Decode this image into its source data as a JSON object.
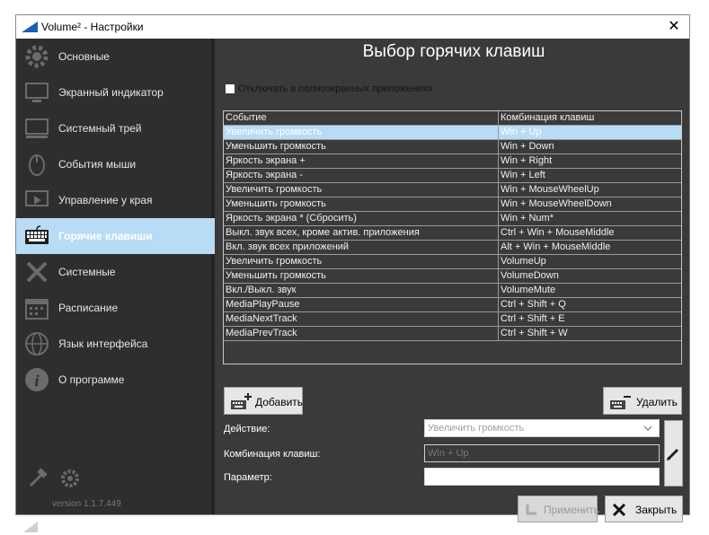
{
  "window": {
    "title": "Volume² - Настройки",
    "close_glyph": "✕",
    "accent_color": "#b8dcf5"
  },
  "sidebar": {
    "items": [
      {
        "label": "Основные",
        "icon": "gear-icon"
      },
      {
        "label": "Экранный индикатор",
        "icon": "monitor-icon"
      },
      {
        "label": "Системный трей",
        "icon": "tray-icon"
      },
      {
        "label": "События мыши",
        "icon": "mouse-icon"
      },
      {
        "label": "Управление у края",
        "icon": "screen-edge-icon"
      },
      {
        "label": "Горячие клавиши",
        "icon": "keyboard-icon",
        "active": true
      },
      {
        "label": "Системные",
        "icon": "tools-icon"
      },
      {
        "label": "Расписание",
        "icon": "calendar-icon"
      },
      {
        "label": "Язык интерфейса",
        "icon": "globe-icon"
      },
      {
        "label": "О программе",
        "icon": "info-icon"
      }
    ],
    "version": "version 1.1.7.449",
    "logo_sup": "2"
  },
  "main": {
    "heading": "Выбор горячих клавиш",
    "fullscreen_checkbox": {
      "label": "Отключать в полноэкранных приложениях",
      "checked": false
    },
    "table": {
      "headers": [
        "Событие",
        "Комбинация клавиш"
      ],
      "rows": [
        [
          "Увеличить громкость",
          "Win + Up"
        ],
        [
          "Уменьшить громкость",
          "Win + Down"
        ],
        [
          "Яркость экрана +",
          "Win + Right"
        ],
        [
          "Яркость экрана -",
          "Win + Left"
        ],
        [
          "Увеличить громкость",
          "Win + MouseWheelUp"
        ],
        [
          "Уменьшить громкость",
          "Win + MouseWheelDown"
        ],
        [
          "Яркость экрана * (Сбросить)",
          "Win + Num*"
        ],
        [
          "Выкл. звук всех, кроме актив. приложения",
          "Ctrl + Win + MouseMiddle"
        ],
        [
          "Вкл. звук всех приложений",
          "Alt + Win + MouseMiddle"
        ],
        [
          "Увеличить громкость",
          "VolumeUp"
        ],
        [
          "Уменьшить громкость",
          "VolumeDown"
        ],
        [
          "Вкл./Выкл. звук",
          "VolumeMute"
        ],
        [
          "MediaPlayPause",
          "Ctrl + Shift + Q"
        ],
        [
          "MediaNextTrack",
          "Ctrl + Shift + E"
        ],
        [
          "MediaPrevTrack",
          "Ctrl + Shift + W"
        ]
      ],
      "selected_row": 0
    },
    "add_button": "Добавить",
    "delete_button": "Удалить",
    "form": {
      "action_label": "Действие:",
      "action_value": "Увеличить громкость",
      "combo_label": "Комбинация клавиш:",
      "combo_value": "Win + Up",
      "param_label": "Параметр:",
      "param_value": ""
    },
    "apply_button": "Применить",
    "close_button": "Закрыть"
  }
}
